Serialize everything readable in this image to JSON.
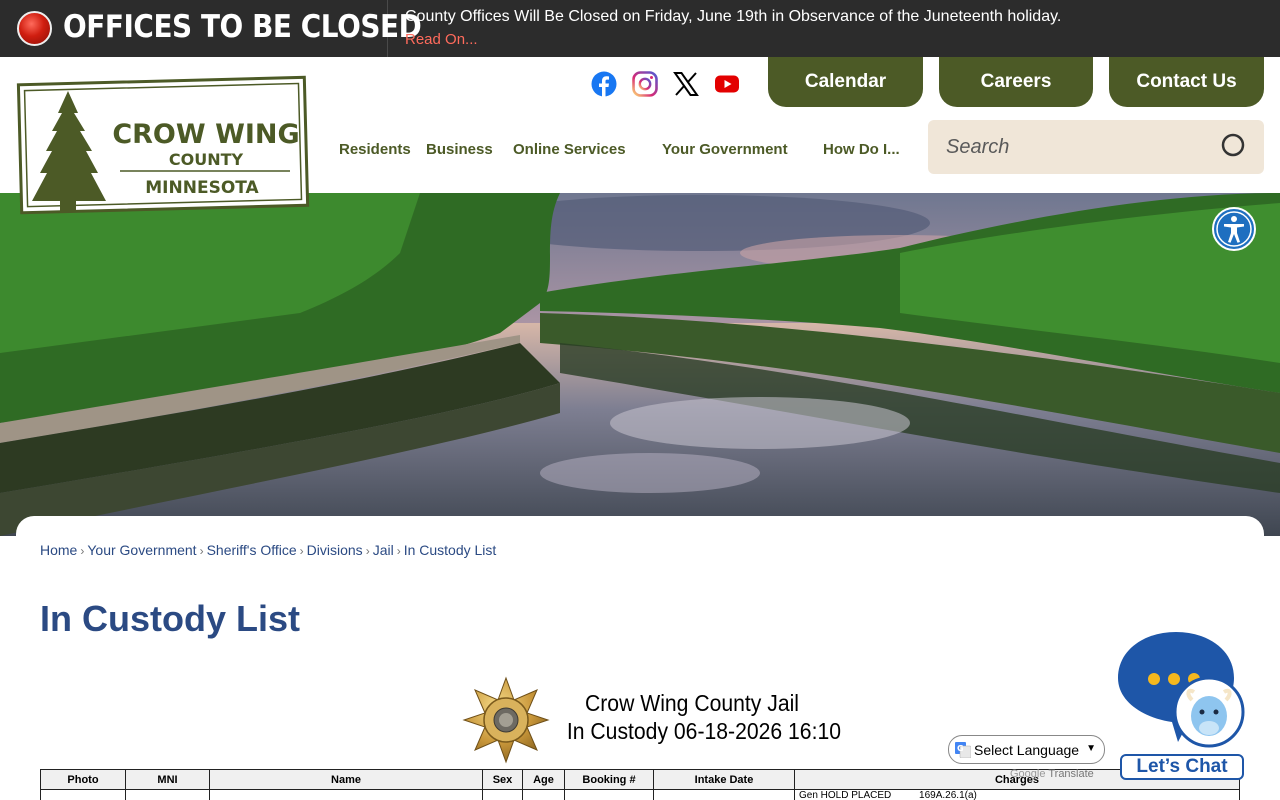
{
  "alert": {
    "heading": "OFFICES TO BE CLOSED",
    "message": "County Offices Will Be Closed on Friday, June 19th in Observance of the Juneteenth holiday.",
    "link": "Read On..."
  },
  "logo": {
    "line1": "CROW WING",
    "line2": "COUNTY",
    "line3": "MINNESOTA"
  },
  "social": [
    "facebook-icon",
    "instagram-icon",
    "x-icon",
    "youtube-icon"
  ],
  "top_buttons": {
    "calendar": "Calendar",
    "careers": "Careers",
    "contact": "Contact Us"
  },
  "nav": {
    "residents": "Residents",
    "business": "Business",
    "online_services": "Online Services",
    "your_government": "Your Government",
    "how_do_i": "How Do I..."
  },
  "search": {
    "placeholder": "Search"
  },
  "breadcrumb": {
    "home": "Home",
    "your_government": "Your Government",
    "sheriffs_office": "Sheriff's Office",
    "divisions": "Divisions",
    "jail": "Jail",
    "current": "In Custody List"
  },
  "page_title": "In Custody List",
  "report": {
    "jail_name": "Crow Wing County Jail",
    "custody_date": "In Custody 06-18-2026 16:10",
    "columns": [
      "Photo",
      "MNI",
      "Name",
      "Sex",
      "Age",
      "Booking #",
      "Intake Date",
      "Charges"
    ],
    "first_row_charge": "Gen HOLD PLACED          169A.26.1(a)"
  },
  "translate": {
    "select_label": "Select Language",
    "powered_prefix": "Google",
    "powered_suffix": "Translate"
  },
  "chat": {
    "label": "Let’s Chat"
  },
  "colors": {
    "brand_green": "#4c5a26",
    "brand_blue": "#2b4a83",
    "alert_bg": "#2c2c2c",
    "alert_link": "#ff6b5c",
    "search_bg": "#f0e6d8"
  }
}
